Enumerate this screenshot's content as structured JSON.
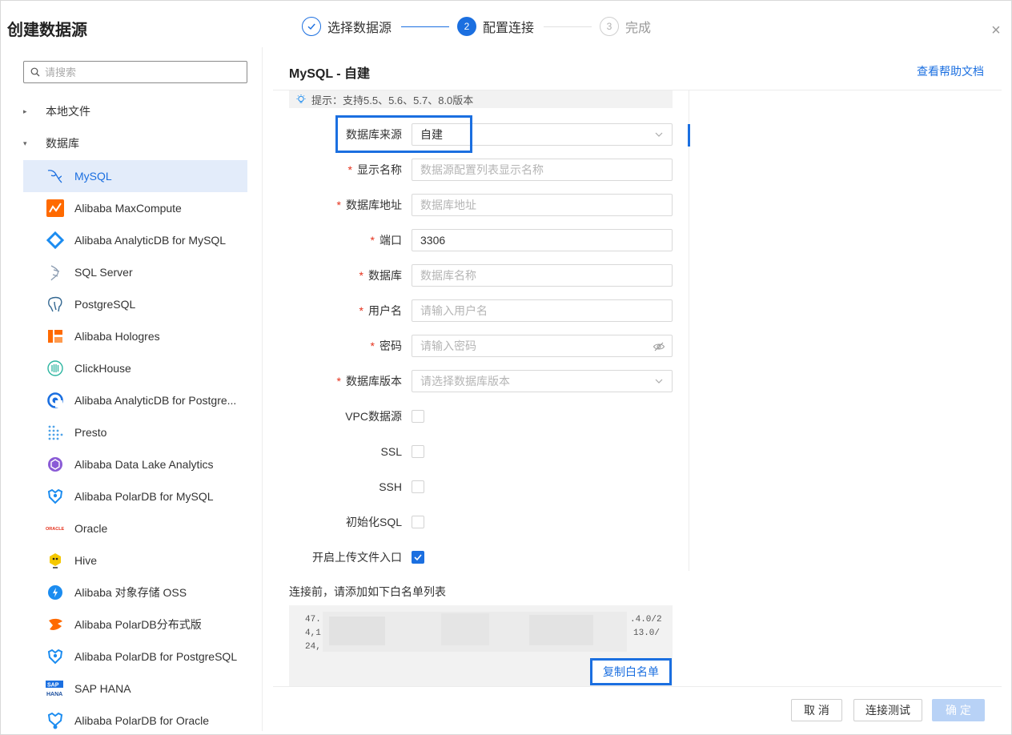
{
  "dialog": {
    "title": "创建数据源",
    "close_glyph": "×"
  },
  "steps": [
    {
      "label": "选择数据源",
      "status": "done",
      "num": "✓"
    },
    {
      "label": "配置连接",
      "status": "active",
      "num": "2"
    },
    {
      "label": "完成",
      "status": "pending",
      "num": "3"
    }
  ],
  "sidebar": {
    "search_placeholder": "请搜索",
    "nodes": [
      {
        "label": "本地文件",
        "expanded": false,
        "tri": "▸"
      },
      {
        "label": "数据库",
        "expanded": true,
        "tri": "▾"
      }
    ],
    "items": [
      {
        "label": "MySQL",
        "icon": "mysql-dolphin-icon",
        "selected": true
      },
      {
        "label": "Alibaba MaxCompute",
        "icon": "maxcompute-icon"
      },
      {
        "label": "Alibaba AnalyticDB for MySQL",
        "icon": "analyticdb-icon"
      },
      {
        "label": "SQL Server",
        "icon": "sqlserver-icon"
      },
      {
        "label": "PostgreSQL",
        "icon": "postgresql-elephant-icon"
      },
      {
        "label": "Alibaba Hologres",
        "icon": "hologres-icon"
      },
      {
        "label": "ClickHouse",
        "icon": "clickhouse-icon"
      },
      {
        "label": "Alibaba AnalyticDB for Postgre...",
        "icon": "analyticdb-pg-icon"
      },
      {
        "label": "Presto",
        "icon": "presto-icon"
      },
      {
        "label": "Alibaba Data Lake Analytics",
        "icon": "data-lake-icon"
      },
      {
        "label": "Alibaba PolarDB for MySQL",
        "icon": "polardb-mysql-icon"
      },
      {
        "label": "Oracle",
        "icon": "oracle-logo-icon"
      },
      {
        "label": "Hive",
        "icon": "hive-icon"
      },
      {
        "label": "Alibaba 对象存储 OSS",
        "icon": "oss-cloud-icon"
      },
      {
        "label": "Alibaba PolarDB分布式版",
        "icon": "polardb-x-icon"
      },
      {
        "label": "Alibaba PolarDB for PostgreSQL",
        "icon": "polardb-pg-icon"
      },
      {
        "label": "SAP HANA",
        "icon": "sap-hana-icon"
      },
      {
        "label": "Alibaba PolarDB for Oracle",
        "icon": "polardb-oracle-icon"
      }
    ]
  },
  "main": {
    "title": "MySQL - 自建",
    "help_link": "查看帮助文档",
    "tip": "提示：支持5.5、5.6、5.7、8.0版本",
    "fields": {
      "source": {
        "label": "数据库来源",
        "value": "自建"
      },
      "display_name": {
        "label": "显示名称",
        "placeholder": "数据源配置列表显示名称"
      },
      "host": {
        "label": "数据库地址",
        "placeholder": "数据库地址"
      },
      "port": {
        "label": "端口",
        "value": "3306"
      },
      "database": {
        "label": "数据库",
        "placeholder": "数据库名称"
      },
      "username": {
        "label": "用户名",
        "placeholder": "请输入用户名"
      },
      "password": {
        "label": "密码",
        "placeholder": "请输入密码"
      },
      "version": {
        "label": "数据库版本",
        "placeholder": "请选择数据库版本"
      },
      "vpc": {
        "label": "VPC数据源",
        "checked": false
      },
      "ssl": {
        "label": "SSL",
        "checked": false
      },
      "ssh": {
        "label": "SSH",
        "checked": false
      },
      "init_sql": {
        "label": "初始化SQL",
        "checked": false
      },
      "upload": {
        "label": "开启上传文件入口",
        "checked": true
      }
    },
    "required_mark": "*",
    "whitelist": {
      "title": "连接前，请添加如下白名单列表",
      "lines": [
        {
          "left": "47.",
          "right": ".4.0/2"
        },
        {
          "left": "4,1",
          "right": "13.0/"
        },
        {
          "left": "24,",
          "right": ""
        }
      ],
      "copy_label": "复制白名单"
    }
  },
  "footer": {
    "cancel": "取 消",
    "test": "连接测试",
    "confirm": "确 定"
  },
  "colors": {
    "accent": "#1b6fe0",
    "required": "#e5311c",
    "selected_bg": "#e3ecfa"
  }
}
